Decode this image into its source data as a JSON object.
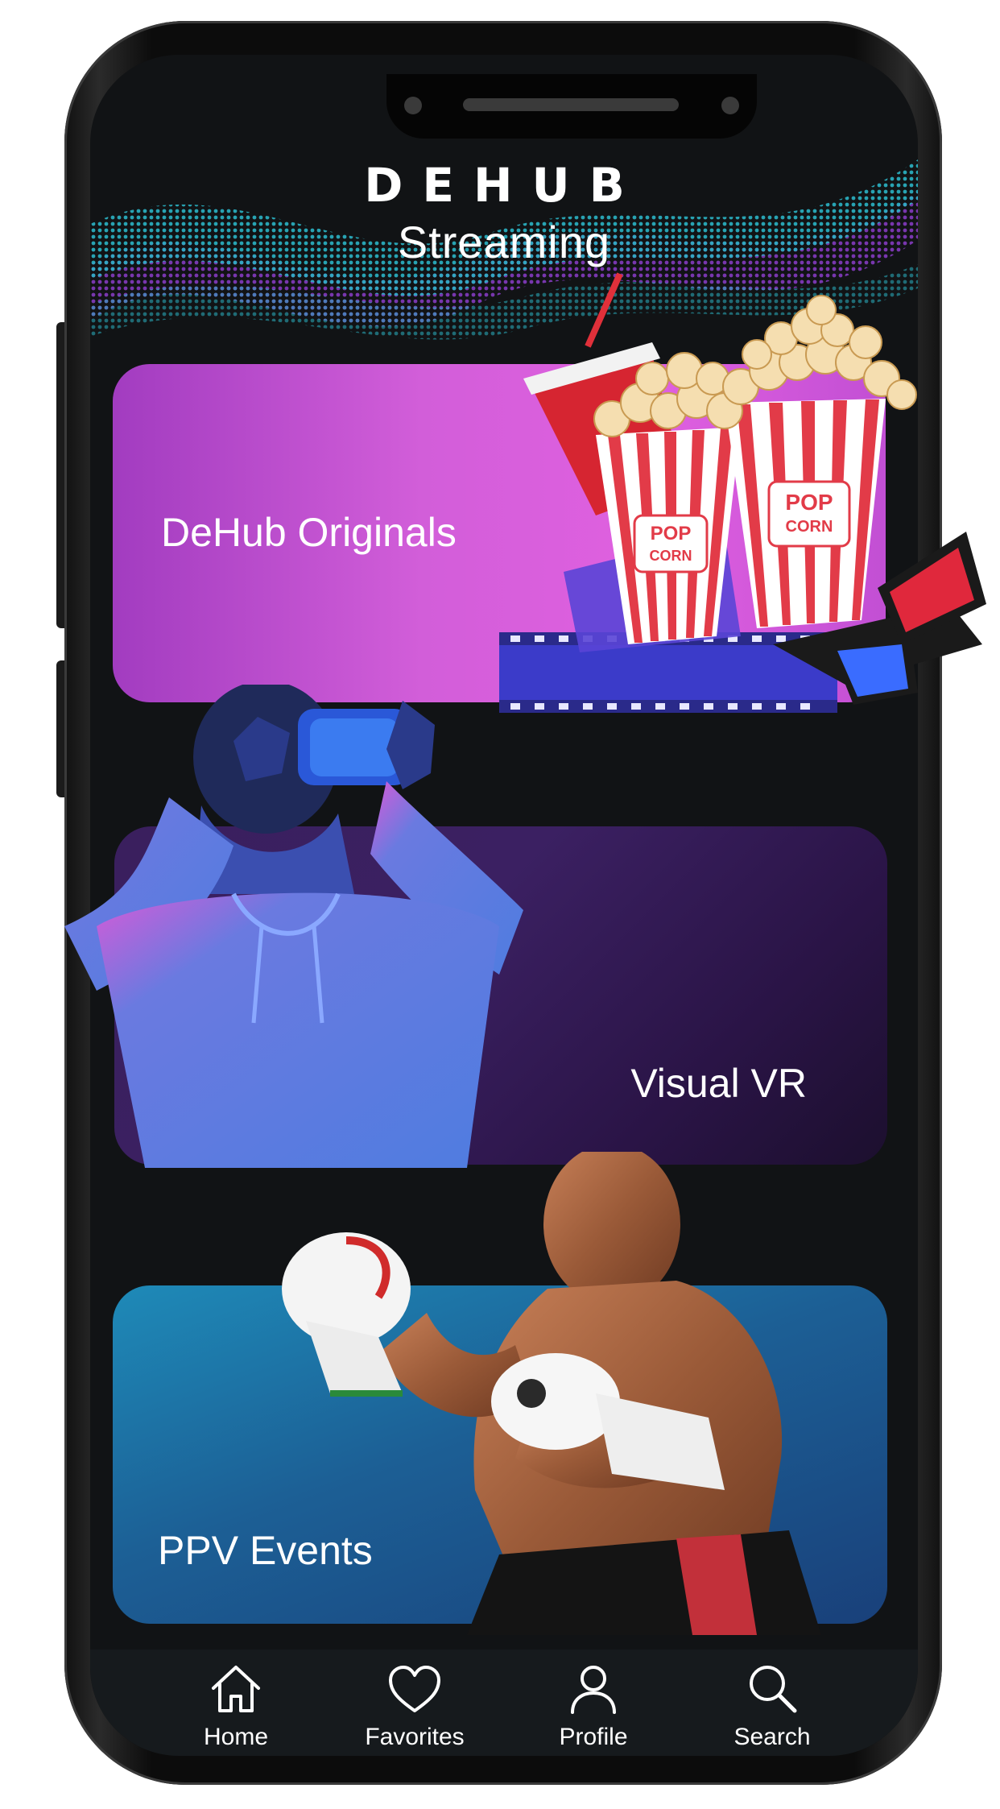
{
  "app": {
    "logo_text": "DEHUB",
    "subtitle": "Streaming"
  },
  "cards": [
    {
      "label": "DeHub Originals",
      "image": "popcorn-drink-3d-glasses-film-reel"
    },
    {
      "label": "Visual VR",
      "image": "person-wearing-vr-headset"
    },
    {
      "label": "PPV Events",
      "image": "boxer-in-fighting-stance"
    }
  ],
  "nav": {
    "items": [
      {
        "label": "Home",
        "icon": "home-icon"
      },
      {
        "label": "Favorites",
        "icon": "heart-icon"
      },
      {
        "label": "Profile",
        "icon": "user-icon"
      },
      {
        "label": "Search",
        "icon": "search-icon"
      }
    ]
  },
  "colors": {
    "originals_card": "#d25ed9",
    "vr_card": "#3b2062",
    "ppv_card": "#1c5f95",
    "wave_teal": "#2bb3c4",
    "wave_purple": "#8a3cc9"
  }
}
